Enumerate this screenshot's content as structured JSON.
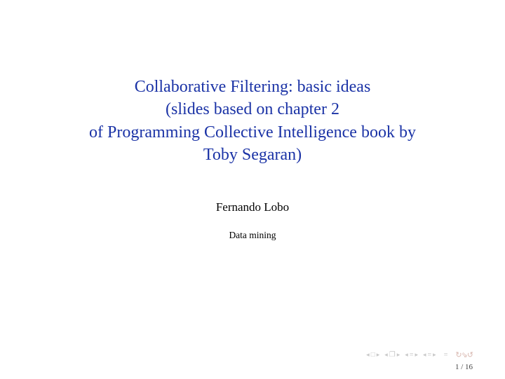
{
  "title": {
    "line1": "Collaborative Filtering: basic ideas",
    "line2": "(slides based on chapter 2",
    "line3": "of Programming Collective Intelligence book by",
    "line4": "Toby Segaran)"
  },
  "author": "Fernando Lobo",
  "course": "Data mining",
  "nav": {
    "first_symbol": "□",
    "section_symbol": "❐",
    "subsection_symbol": "≡",
    "slide_symbol": "≡",
    "end_symbol": "≡",
    "loop_symbol": "↻⇘↺"
  },
  "page": {
    "current": 1,
    "total": 16,
    "sep": " / "
  }
}
